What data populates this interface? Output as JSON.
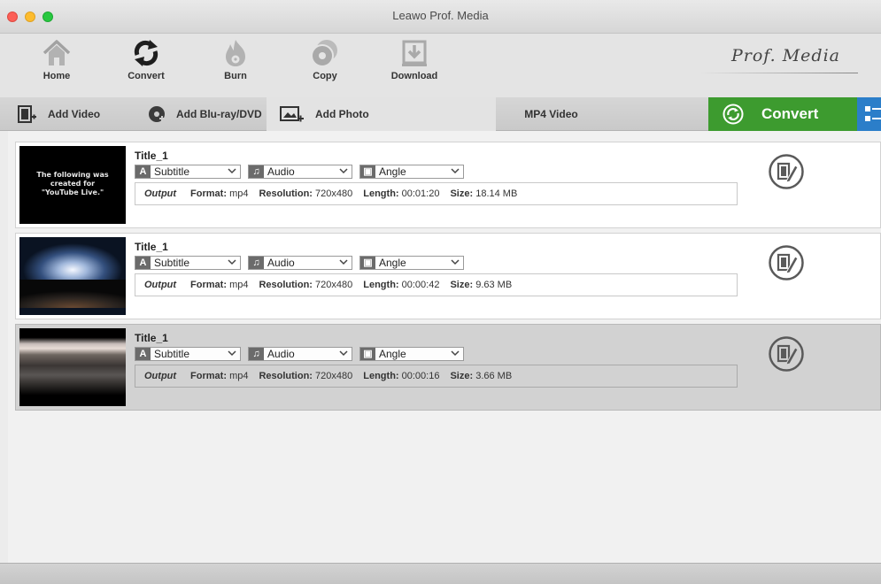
{
  "window": {
    "title": "Leawo Prof. Media"
  },
  "toolbar": {
    "tools": [
      {
        "label": "Home",
        "icon": "home-icon"
      },
      {
        "label": "Convert",
        "icon": "convert-icon"
      },
      {
        "label": "Burn",
        "icon": "burn-icon"
      },
      {
        "label": "Copy",
        "icon": "copy-icon"
      },
      {
        "label": "Download",
        "icon": "download-icon"
      }
    ],
    "brand": "Prof. Media"
  },
  "actionbar": {
    "add_video": "Add Video",
    "add_bluray": "Add Blu-ray/DVD",
    "add_photo": "Add Photo",
    "format": "MP4 Video",
    "convert": "Convert"
  },
  "labels": {
    "output": "Output",
    "format": "Format:",
    "resolution": "Resolution:",
    "length": "Length:",
    "size": "Size:"
  },
  "items": [
    {
      "title": "Title_1",
      "subtitle": "Subtitle",
      "audio": "Audio",
      "angle": "Angle",
      "format": "mp4",
      "resolution": "720x480",
      "length": "00:01:20",
      "size": "18.14 MB",
      "thumb_text": "The following was created for \"YouTube Live.\"",
      "selected": false
    },
    {
      "title": "Title_1",
      "subtitle": "Subtitle",
      "audio": "Audio",
      "angle": "Angle",
      "format": "mp4",
      "resolution": "720x480",
      "length": "00:00:42",
      "size": "9.63 MB",
      "selected": false
    },
    {
      "title": "Title_1",
      "subtitle": "Subtitle",
      "audio": "Audio",
      "angle": "Angle",
      "format": "mp4",
      "resolution": "720x480",
      "length": "00:00:16",
      "size": "3.66 MB",
      "selected": true
    }
  ],
  "colors": {
    "convert_button": "#3d9b2f",
    "layout_button": "#2b7ec9",
    "selected_row": "#d2d2d2"
  }
}
